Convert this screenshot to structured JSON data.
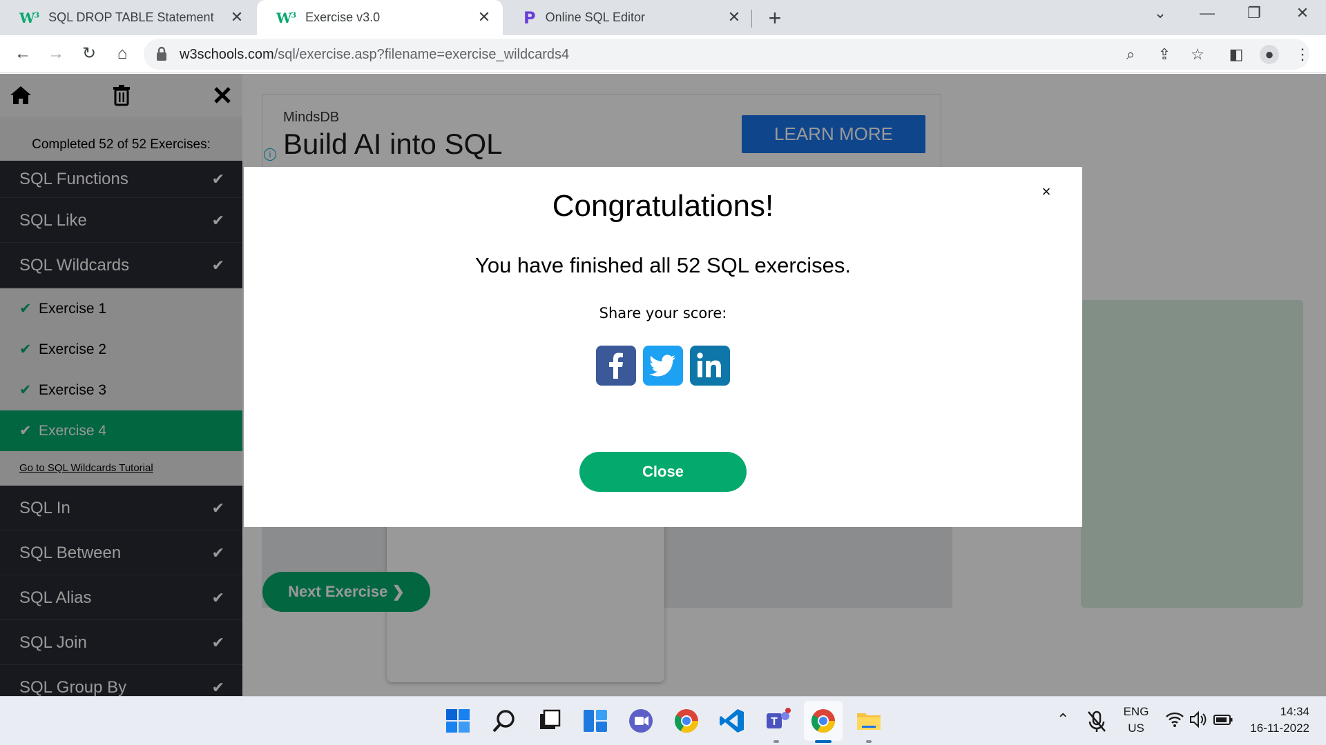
{
  "browser": {
    "tabs": [
      {
        "title": "SQL DROP TABLE Statement",
        "icon": "w3schools-icon",
        "active": false
      },
      {
        "title": "Exercise v3.0",
        "icon": "w3schools-icon",
        "active": true
      },
      {
        "title": "Online SQL Editor",
        "icon": "programiz-icon",
        "active": false
      }
    ],
    "url_host": "w3schools.com",
    "url_path": "/sql/exercise.asp?filename=exercise_wildcards4"
  },
  "sidebar": {
    "completed_text": "Completed 52 of 52 Exercises:",
    "items_top": [
      {
        "label": "SQL Functions"
      },
      {
        "label": "SQL Like"
      },
      {
        "label": "SQL Wildcards"
      }
    ],
    "exercises": [
      {
        "label": "Exercise 1",
        "active": false
      },
      {
        "label": "Exercise 2",
        "active": false
      },
      {
        "label": "Exercise 3",
        "active": false
      },
      {
        "label": "Exercise 4",
        "active": true
      }
    ],
    "tutorial_link": "Go to SQL Wildcards Tutorial",
    "items_bottom": [
      {
        "label": "SQL In"
      },
      {
        "label": "SQL Between"
      },
      {
        "label": "SQL Alias"
      },
      {
        "label": "SQL Join"
      },
      {
        "label": "SQL Group By"
      }
    ]
  },
  "ad": {
    "brand": "MindsDB",
    "headline": "Build AI into SQL",
    "cta": "LEARN MORE"
  },
  "page": {
    "next_button": "Next Exercise ❯"
  },
  "modal": {
    "title": "Congratulations!",
    "message": "You have finished all 52 SQL exercises.",
    "share_label": "Share your score:",
    "close_button": "Close",
    "close_x": "×"
  },
  "taskbar": {
    "lang": "ENG",
    "region": "US",
    "time": "14:34",
    "date": "16-11-2022"
  },
  "colors": {
    "w3_green": "#04aa6d",
    "sidebar_dark": "#282a35",
    "facebook": "#3b5998",
    "twitter": "#1da1f2",
    "linkedin": "#0e76a8",
    "ad_button": "#1a73e8"
  }
}
